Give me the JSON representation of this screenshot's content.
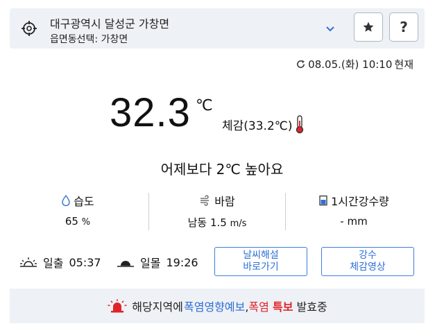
{
  "location": {
    "address": "대구광역시 달성군 가창면",
    "select_label": "읍면동선택:",
    "select_value": "가창면"
  },
  "updated": {
    "datetime": "08.05.(화) 10:10",
    "suffix": "현재"
  },
  "current": {
    "temperature": "32.3",
    "unit": "℃",
    "feels_label": "체감(33.2℃)",
    "compare_text": "어제보다 2℃ 높아요"
  },
  "stats": [
    {
      "label": "습도",
      "value": "65",
      "unit": "%",
      "icon": "droplet-icon"
    },
    {
      "label": "바람",
      "value": "남동 1.5",
      "unit": "m/s",
      "icon": "wind-icon"
    },
    {
      "label": "1시간강수량",
      "value": "-",
      "unit": "mm",
      "icon": "rain-gauge-icon"
    }
  ],
  "sun": {
    "sunrise_label": "일출",
    "sunrise_time": "05:37",
    "sunset_label": "일몰",
    "sunset_time": "19:26"
  },
  "buttons": {
    "interpretation_line1": "날씨해설",
    "interpretation_line2": "바로가기",
    "precip_line1": "강수",
    "precip_line2": "체감영상",
    "help": "?"
  },
  "alert": {
    "prefix": "해당지역에",
    "impact_forecast": "폭염영향예보",
    "separator": ",",
    "heat": "폭염",
    "special": "특보",
    "suffix": "발효중"
  },
  "colors": {
    "accent_blue": "#2f6fd6",
    "alert_red": "#e0232b",
    "panel_bg": "#eef1f5"
  }
}
